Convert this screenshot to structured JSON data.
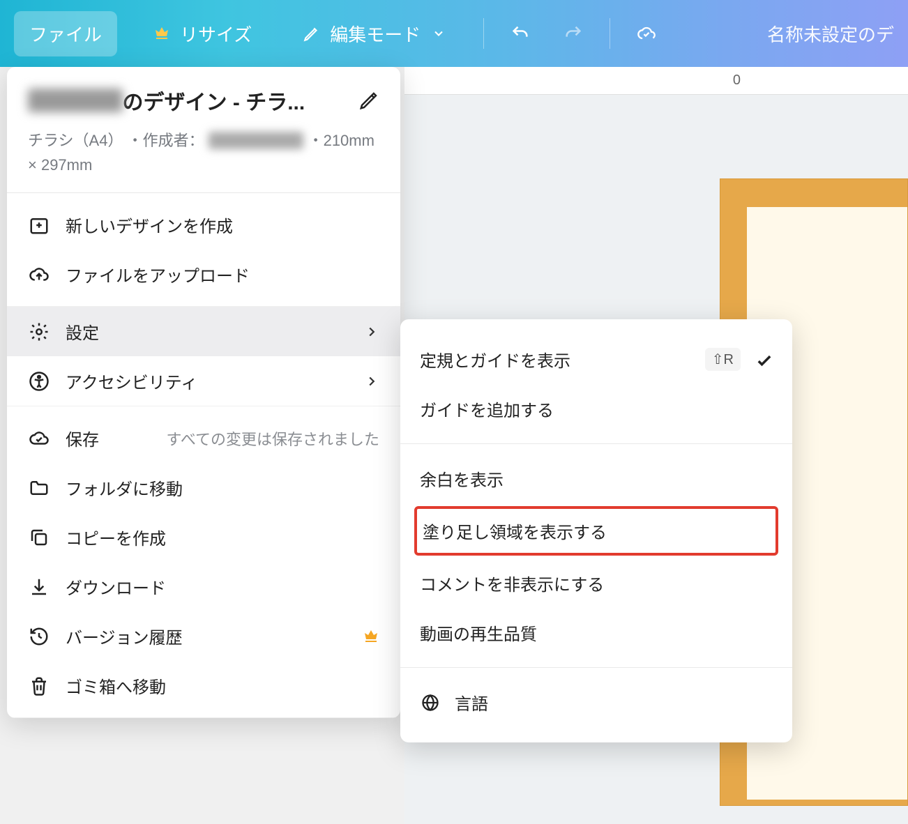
{
  "toolbar": {
    "file": "ファイル",
    "resize": "リサイズ",
    "edit_mode": "編集モード",
    "doc_title": "名称未設定のデ"
  },
  "ruler": {
    "tick": "0"
  },
  "dropdown": {
    "title_prefix_redacted": "██████",
    "title_suffix": "のデザイン - チラ...",
    "sub_type": "チラシ（A4）",
    "sub_author_label": "・作成者：",
    "sub_author_redacted": "████████",
    "sub_dims": "・210mm × 297mm",
    "items": {
      "new_design": "新しいデザインを作成",
      "upload_file": "ファイルをアップロード",
      "settings": "設定",
      "accessibility": "アクセシビリティ",
      "save": "保存",
      "save_status": "すべての変更は保存されました",
      "move_folder": "フォルダに移動",
      "make_copy": "コピーを作成",
      "download": "ダウンロード",
      "version_history": "バージョン履歴",
      "move_trash": "ゴミ箱へ移動"
    }
  },
  "submenu": {
    "show_rulers": "定規とガイドを表示",
    "show_rulers_kbd": "⇧R",
    "add_guide": "ガイドを追加する",
    "show_margins": "余白を表示",
    "show_bleed": "塗り足し領域を表示する",
    "hide_comments": "コメントを非表示にする",
    "video_quality": "動画の再生品質",
    "language": "言語"
  }
}
